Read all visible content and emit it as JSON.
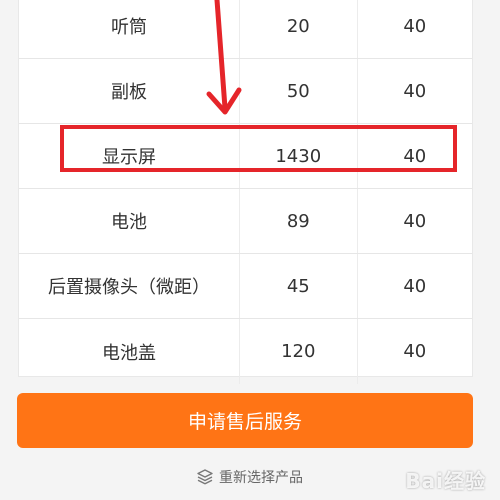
{
  "table": {
    "rows": [
      {
        "name": "听筒",
        "price": "20",
        "qty": "40"
      },
      {
        "name": "副板",
        "price": "50",
        "qty": "40"
      },
      {
        "name": "显示屏",
        "price": "1430",
        "qty": "40"
      },
      {
        "name": "电池",
        "price": "89",
        "qty": "40"
      },
      {
        "name": "后置摄像头（微距）",
        "price": "45",
        "qty": "40"
      },
      {
        "name": "电池盖",
        "price": "120",
        "qty": "40"
      }
    ]
  },
  "actions": {
    "apply_label": "申请售后服务",
    "reselect_label": "重新选择产品"
  },
  "colors": {
    "accent": "#ff7415",
    "highlight": "#e5252a"
  },
  "icons": {
    "reselect": "layers-icon",
    "annotation_arrow": "arrow-down-icon"
  },
  "watermark": "Bai经验"
}
